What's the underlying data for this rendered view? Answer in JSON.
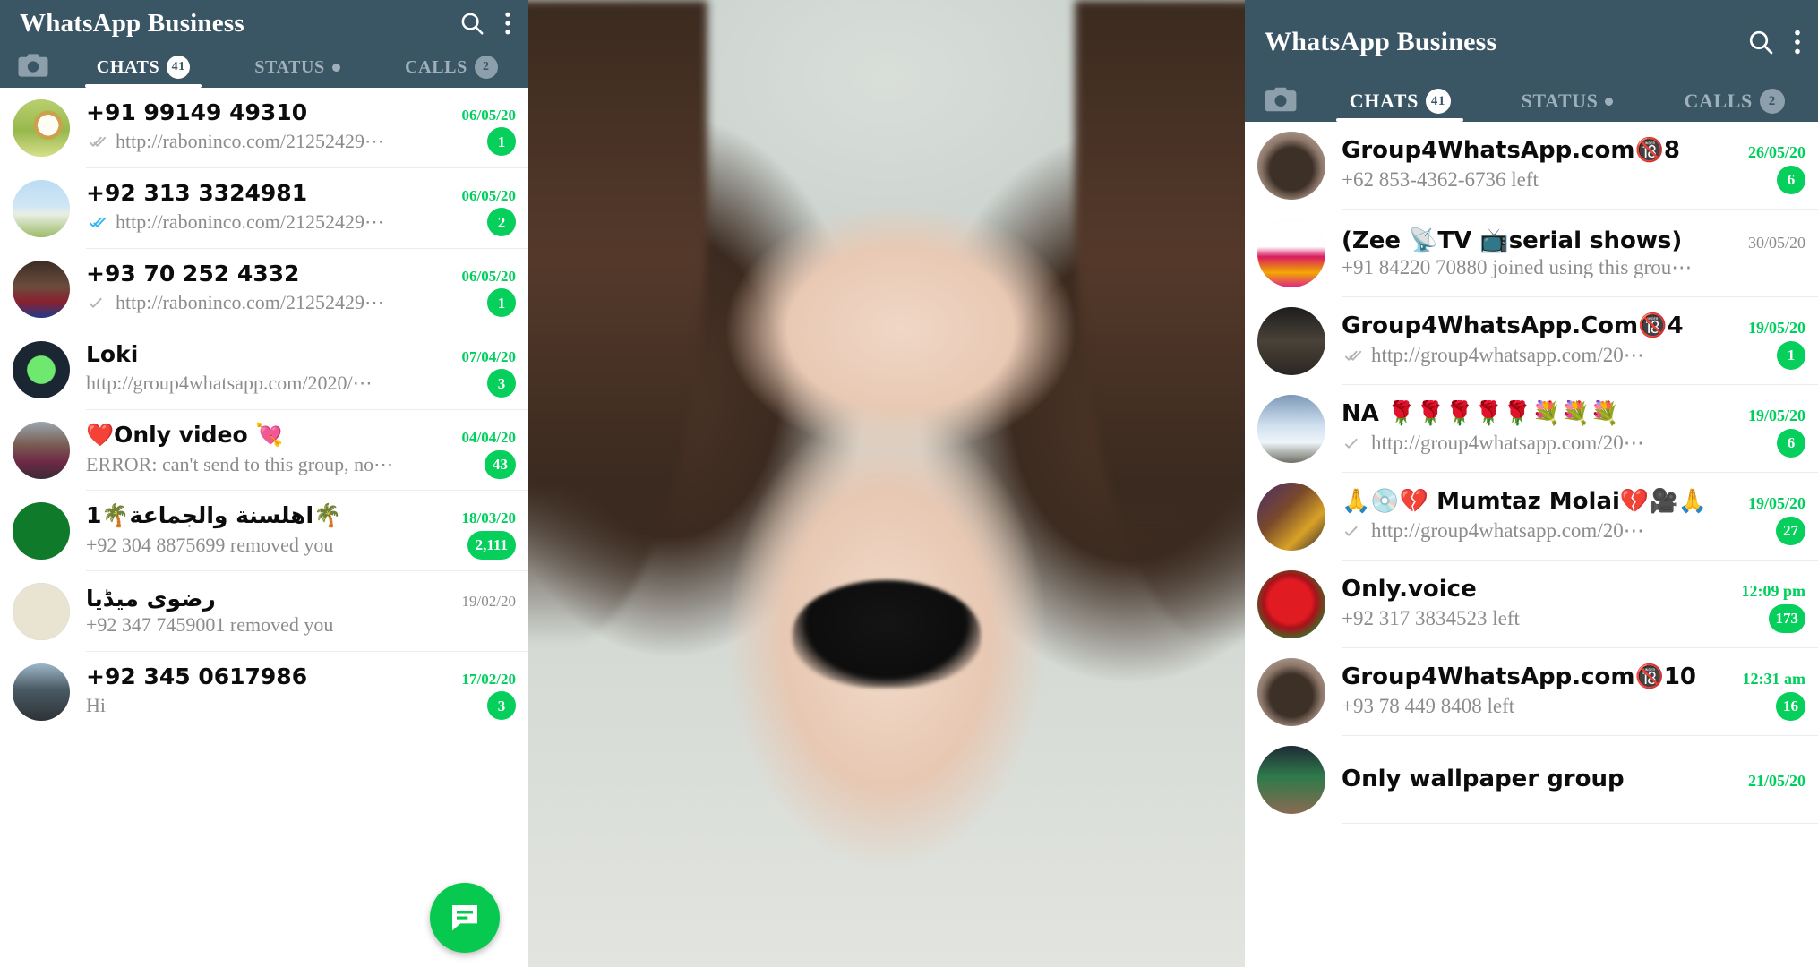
{
  "colors": {
    "appbar": "#3a5665",
    "badge_green": "#06cf5c",
    "time_green": "#00cf5d",
    "time_muted": "#8b8b8b",
    "fab_green": "#08c94f",
    "tab_inactive": "#9eb0ba",
    "divider": "#ececec"
  },
  "left_panel": {
    "header": {
      "title": "WhatsApp Business",
      "search_icon": "search-icon",
      "overflow_icon": "more-vertical-icon",
      "camera_icon": "camera-icon"
    },
    "tabs": [
      {
        "label": "CHATS",
        "count": "41",
        "active": true,
        "dot": false
      },
      {
        "label": "STATUS",
        "count": "",
        "active": false,
        "dot": true
      },
      {
        "label": "CALLS",
        "count": "2",
        "active": false,
        "dot": false
      }
    ],
    "fab": {
      "icon": "new-chat-icon"
    },
    "chats": [
      {
        "name": "+91 99149 49310",
        "message": "http://raboninco.com/21252429⋯",
        "time": "06/05/20",
        "time_style": "green",
        "badge": "1",
        "ticks": "double-grey",
        "avatar": "clock-photo"
      },
      {
        "name": "+92 313 3324981",
        "message": "http://raboninco.com/21252429⋯",
        "time": "06/05/20",
        "time_style": "green",
        "badge": "2",
        "ticks": "double-blue",
        "avatar": "two-children-photo"
      },
      {
        "name": "+93 70 252 4332",
        "message": "http://raboninco.com/21252429⋯",
        "time": "06/05/20",
        "time_style": "green",
        "badge": "1",
        "ticks": "single-grey",
        "avatar": "child-jersey-photo"
      },
      {
        "name": "Loki",
        "message": "http://group4whatsapp.com/2020/⋯",
        "time": "07/04/20",
        "time_style": "green",
        "badge": "3",
        "ticks": "none",
        "avatar": "green-silhouette-logo"
      },
      {
        "name": "❤️Only video 💘",
        "message": "ERROR: can't send to this group, no⋯",
        "time": "04/04/20",
        "time_style": "green",
        "badge": "43",
        "ticks": "none",
        "avatar": "woman-maroon-photo"
      },
      {
        "name": "1🌴اهلسنة والجماعة🌴",
        "message": "+92 304 8875699 removed you",
        "time": "18/03/20",
        "time_style": "green",
        "badge": "2,111",
        "ticks": "none",
        "avatar": "islamic-green-logo"
      },
      {
        "name": "رضوی میڈیا",
        "message": "+92 347 7459001 removed you",
        "time": "19/02/20",
        "time_style": "muted",
        "badge": "",
        "ticks": "none",
        "avatar": "cleric-photo"
      },
      {
        "name": "+92 345 0617986",
        "message": "Hi",
        "time": "17/02/20",
        "time_style": "green",
        "badge": "3",
        "ticks": "none",
        "avatar": "man-reading-photo"
      }
    ]
  },
  "right_panel": {
    "header": {
      "title": "WhatsApp Business",
      "search_icon": "search-icon",
      "overflow_icon": "more-vertical-icon",
      "camera_icon": "camera-icon"
    },
    "tabs": [
      {
        "label": "CHATS",
        "count": "41",
        "active": true,
        "dot": false
      },
      {
        "label": "STATUS",
        "count": "",
        "active": false,
        "dot": true
      },
      {
        "label": "CALLS",
        "count": "2",
        "active": false,
        "dot": false
      }
    ],
    "chats": [
      {
        "name": "Group4WhatsApp.com🔞8",
        "message": "+62 853-4362-6736 left",
        "time": "26/05/20",
        "time_style": "green",
        "badge": "6",
        "ticks": "none",
        "avatar": "tattoo-back-photo"
      },
      {
        "name": "(Zee 📡TV 📺serial shows)",
        "message": "+91 84220 70880 joined using this grou⋯",
        "time": "30/05/20",
        "time_style": "muted",
        "badge": "",
        "ticks": "none",
        "avatar": "tv-channels-logo"
      },
      {
        "name": "Group4WhatsApp.Com🔞4",
        "message": "http://group4whatsapp.com/20⋯",
        "time": "19/05/20",
        "time_style": "green",
        "badge": "1",
        "ticks": "double-grey",
        "avatar": "tattoo-lion-photo"
      },
      {
        "name": "NA 🌹🌹🌹🌹🌹💐💐💐",
        "message": "http://group4whatsapp.com/20⋯",
        "time": "19/05/20",
        "time_style": "green",
        "badge": "6",
        "ticks": "single-grey",
        "avatar": "snow-tree-photo"
      },
      {
        "name": "🙏💿💔 Mumtaz Molai💔🎥🙏",
        "message": "http://group4whatsapp.com/20⋯",
        "time": "19/05/20",
        "time_style": "green",
        "badge": "27",
        "ticks": "single-grey",
        "avatar": "singer-album-photo"
      },
      {
        "name": "Only.voice",
        "message": "+92 317 3834523 left",
        "time": "12:09 pm",
        "time_style": "green",
        "badge": "173",
        "ticks": "none",
        "avatar": "red-rose-photo"
      },
      {
        "name": "Group4WhatsApp.com🔞10",
        "message": "+93 78 449 8408 left",
        "time": "12:31 am",
        "time_style": "green",
        "badge": "16",
        "ticks": "none",
        "avatar": "tattoo-back-photo"
      },
      {
        "name": "Only wallpaper group",
        "message": "",
        "time": "21/05/20",
        "time_style": "green",
        "badge": "",
        "ticks": "none",
        "avatar": "woman-green-photo"
      }
    ]
  },
  "center_image": {
    "description": "photo of a woman lying down"
  }
}
